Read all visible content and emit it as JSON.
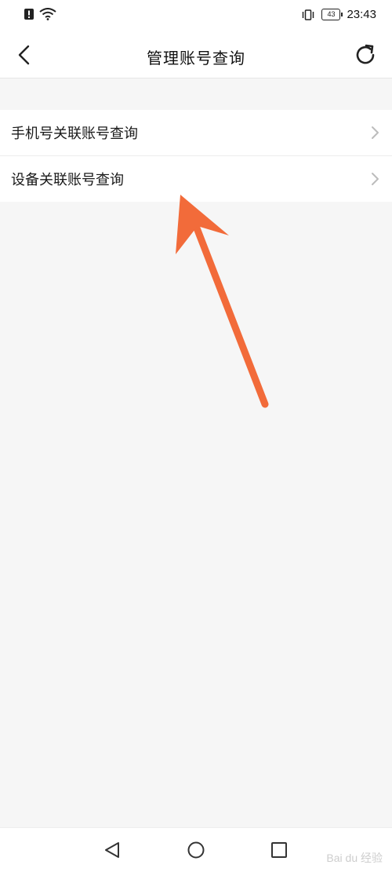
{
  "status_bar": {
    "time": "23:43",
    "battery_level": "43",
    "icons": [
      "alert-icon",
      "wifi-icon",
      "vibrate-icon",
      "battery-icon"
    ]
  },
  "header": {
    "title": "管理账号查询",
    "back_icon": "back-arrow-icon",
    "refresh_icon": "refresh-icon"
  },
  "list": {
    "items": [
      {
        "label": "手机号关联账号查询",
        "icon": "chevron-right-icon"
      },
      {
        "label": "设备关联账号查询",
        "icon": "chevron-right-icon"
      }
    ]
  },
  "system_nav": {
    "icons": [
      "nav-back-icon",
      "nav-home-icon",
      "nav-recent-icon"
    ]
  },
  "watermark": {
    "text": "Bai du 经验"
  },
  "colors": {
    "annotation_arrow": "#f26b3a",
    "background": "#f6f6f6"
  }
}
